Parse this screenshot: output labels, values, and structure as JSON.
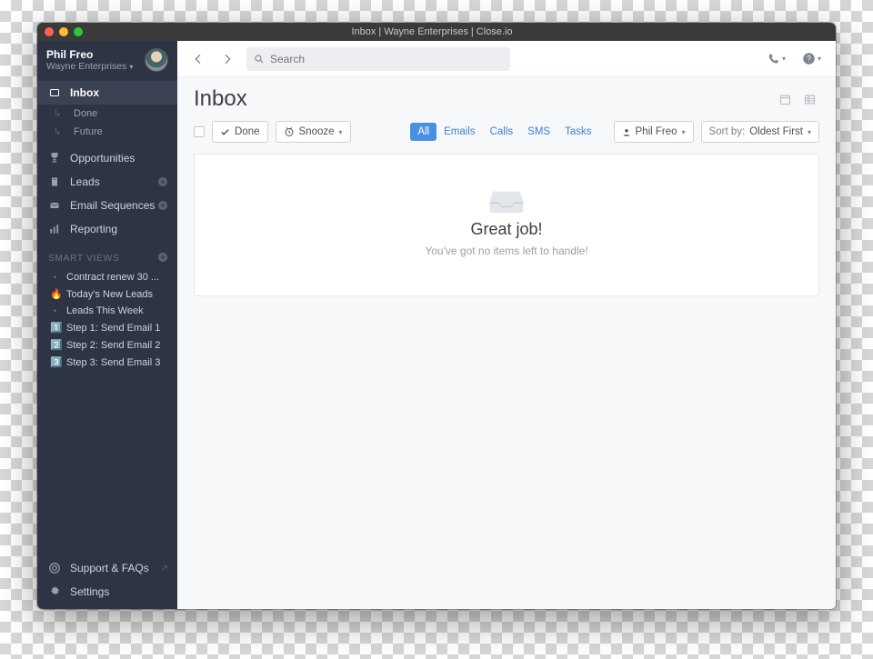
{
  "titlebar": "Inbox | Wayne Enterprises | Close.io",
  "user": {
    "name": "Phil Freo",
    "org": "Wayne Enterprises"
  },
  "nav": {
    "inbox": "Inbox",
    "done": "Done",
    "future": "Future",
    "opportunities": "Opportunities",
    "leads": "Leads",
    "email_sequences": "Email Sequences",
    "reporting": "Reporting"
  },
  "smart_views": {
    "header": "SMART VIEWS",
    "items": [
      {
        "pre": "•",
        "label": "Contract renew 30 ..."
      },
      {
        "pre": "🔥",
        "label": "Today's New Leads"
      },
      {
        "pre": "•",
        "label": "Leads This Week"
      },
      {
        "pre": "1️⃣",
        "label": "Step 1: Send Email 1"
      },
      {
        "pre": "2️⃣",
        "label": "Step 2: Send Email 2"
      },
      {
        "pre": "3️⃣",
        "label": "Step 3: Send Email 3"
      }
    ]
  },
  "bottom": {
    "support": "Support & FAQs",
    "settings": "Settings"
  },
  "search": {
    "placeholder": "Search"
  },
  "page": {
    "title": "Inbox",
    "done_btn": "Done",
    "snooze_btn": "Snooze",
    "tabs": [
      "All",
      "Emails",
      "Calls",
      "SMS",
      "Tasks"
    ],
    "user_filter": "Phil Freo",
    "sort_prefix": "Sort by:",
    "sort_value": "Oldest First",
    "empty_title": "Great job!",
    "empty_sub": "You've got no items left to handle!"
  }
}
